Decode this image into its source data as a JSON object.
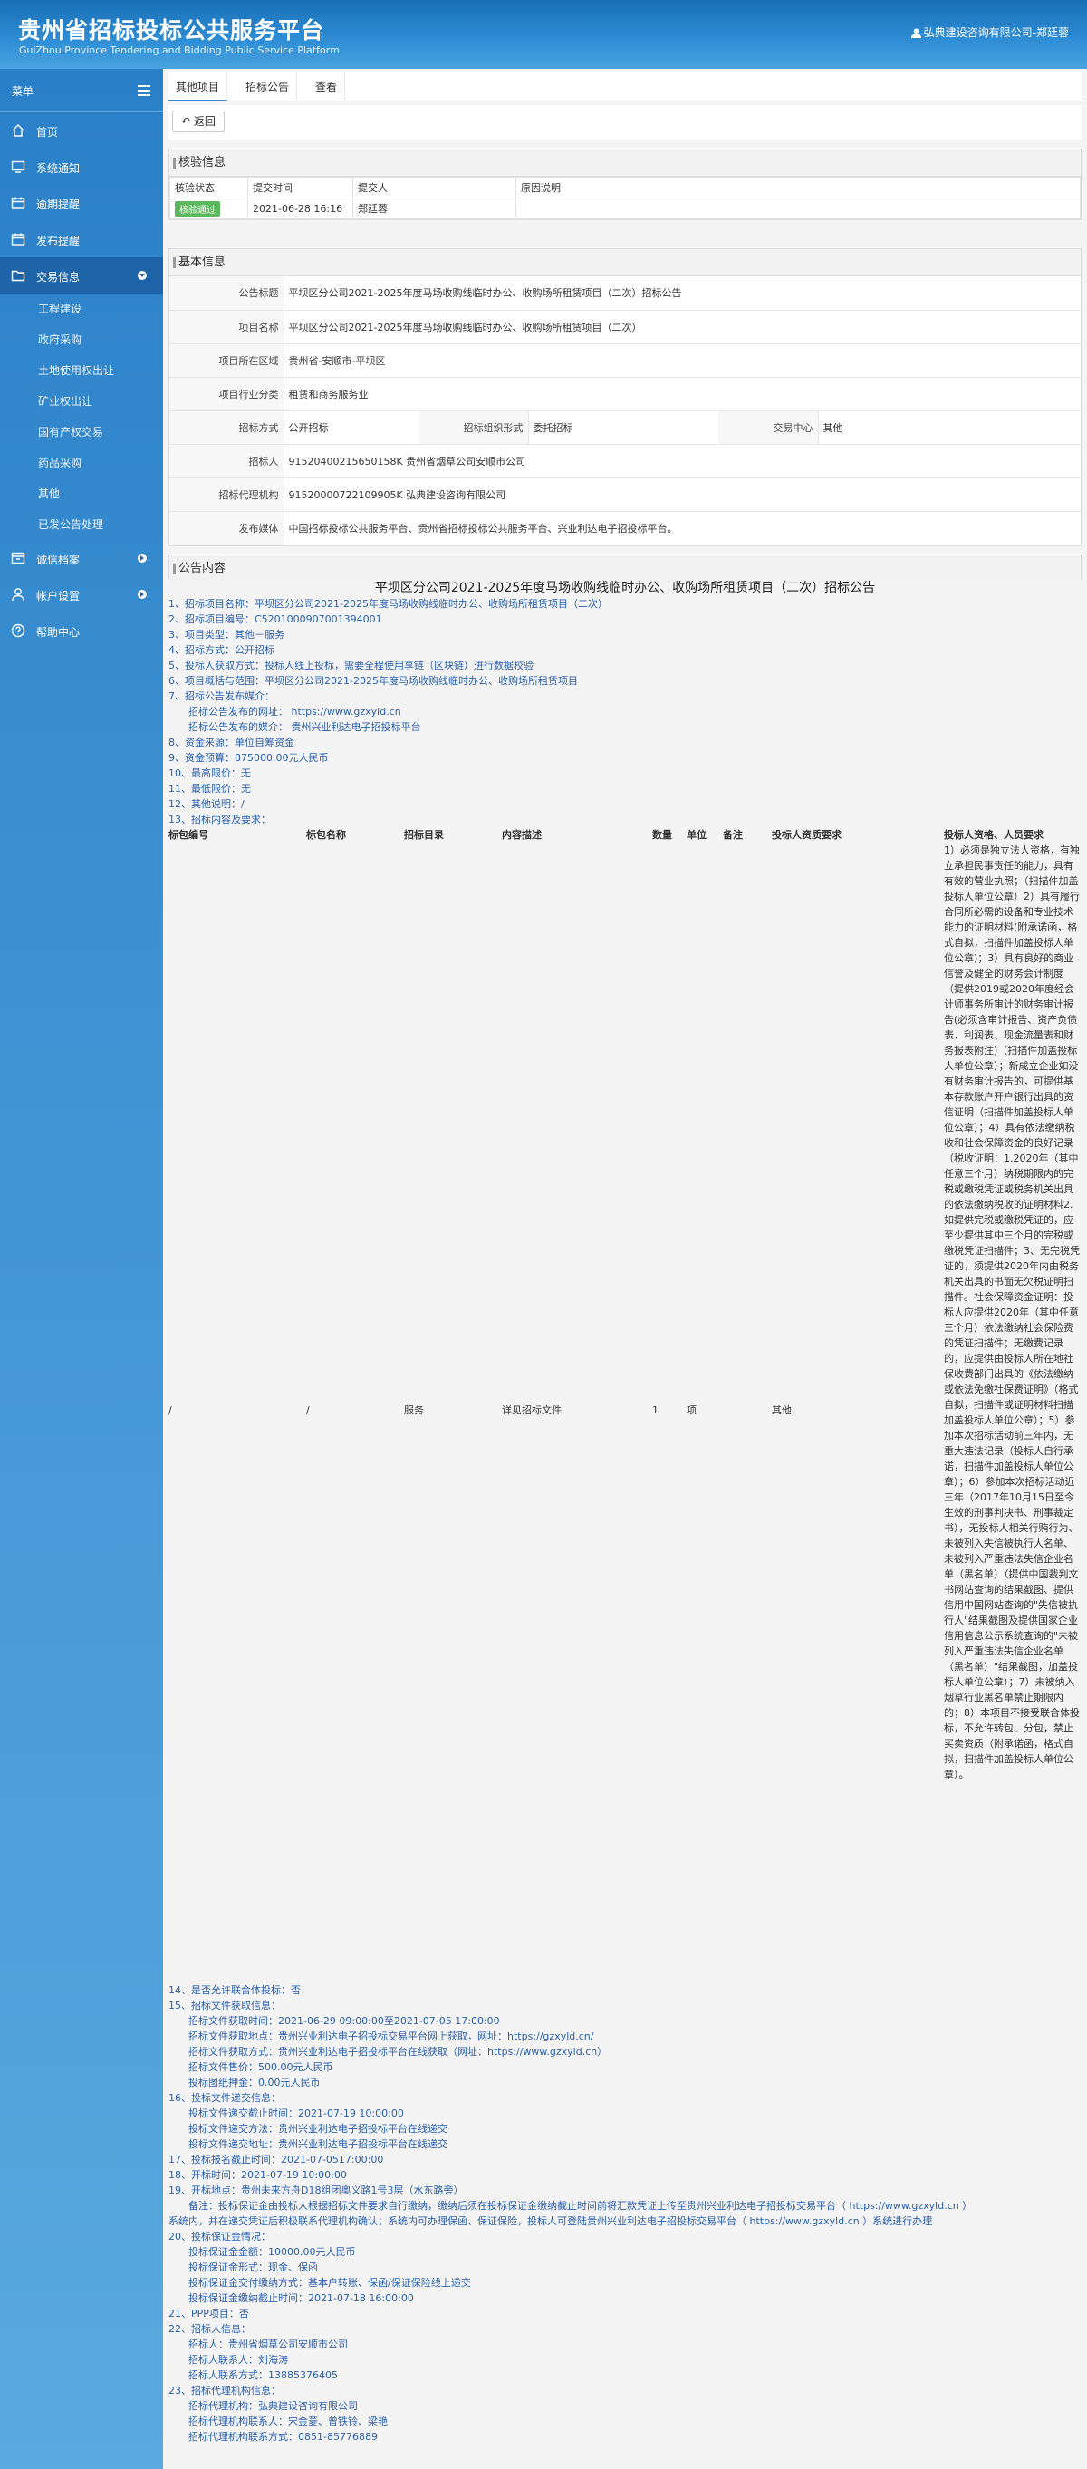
{
  "header": {
    "title": "贵州省招标投标公共服务平台",
    "subtitle": "GuiZhou Province Tendering and Bidding Public Service Platform",
    "user": "弘典建设咨询有限公司-郑廷蓉"
  },
  "sidebar": {
    "menu_label": "菜单",
    "items": [
      {
        "label": "首页"
      },
      {
        "label": "系统通知"
      },
      {
        "label": "逾期提醒"
      },
      {
        "label": "发布提醒"
      },
      {
        "label": "交易信息"
      }
    ],
    "sub_items": [
      "工程建设",
      "政府采购",
      "土地使用权出让",
      "矿业权出让",
      "国有产权交易",
      "药品采购",
      "其他",
      "已发公告处理"
    ],
    "bottom_items": [
      {
        "label": "诚信档案"
      },
      {
        "label": "帐户设置"
      },
      {
        "label": "帮助中心"
      }
    ]
  },
  "breadcrumb": [
    "其他项目",
    "招标公告",
    "查看"
  ],
  "toolbar": {
    "back_label": "返回"
  },
  "check": {
    "title": "核验信息",
    "headers": [
      "核验状态",
      "提交时间",
      "提交人",
      "原因说明"
    ],
    "status": "核验通过",
    "time": "2021-06-28 16:16",
    "submitter": "郑廷蓉",
    "reason": ""
  },
  "basic": {
    "title": "基本信息",
    "announcement_title_label": "公告标题",
    "announcement_title": "平坝区分公司2021-2025年度马场收购线临时办公、收购场所租赁项目（二次）招标公告",
    "project_name_label": "项目名称",
    "project_name": "平坝区分公司2021-2025年度马场收购线临时办公、收购场所租赁项目（二次）",
    "region_label": "项目所在区域",
    "region": "贵州省-安顺市-平坝区",
    "industry_label": "项目行业分类",
    "industry": "租赁和商务服务业",
    "method_label": "招标方式",
    "method": "公开招标",
    "org_form_label": "招标组织形式",
    "org_form": "委托招标",
    "center_label": "交易中心",
    "center": "其他",
    "tenderer_label": "招标人",
    "tenderer": "91520400215650158K 贵州省烟草公司安顺市公司",
    "agency_label": "招标代理机构",
    "agency": "91520000722109905K 弘典建设咨询有限公司",
    "media_label": "发布媒体",
    "media": "中国招标投标公共服务平台、贵州省招标投标公共服务平台、兴业利达电子招投标平台。"
  },
  "notice": {
    "title": "公告内容",
    "doc_title": "平坝区分公司2021-2025年度马场收购线临时办公、收购场所租赁项目（二次）招标公告",
    "lines_a": [
      "1、招标项目名称：平坝区分公司2021-2025年度马场收购线临时办公、收购场所租赁项目（二次）",
      "2、招标项目编号：C5201000907001394001",
      "3、项目类型：其他－服务",
      "4、招标方式：公开招标",
      "5、投标人获取方式：投标人线上投标，需要全程使用享链（区块链）进行数据校验",
      "6、项目概括与范围：平坝区分公司2021-2025年度马场收购线临时办公、收购场所租赁项目",
      "7、招标公告发布媒介：",
      "@招标公告发布的网址： https://www.gzxyld.cn",
      "@招标公告发布的媒介： 贵州兴业利达电子招投标平台",
      "8、资金来源：单位自筹资金",
      "9、资金预算：875000.00元人民币",
      "10、最高限价：无",
      "11、最低限价：无",
      "12、其他说明：/",
      "13、招标内容及要求："
    ],
    "table_headers": [
      "标包编号",
      "标包名称",
      "招标目录",
      "内容描述",
      "数量",
      "单位",
      "备注",
      "投标人资质要求",
      "投标人资格、人员要求"
    ],
    "table_row": [
      "/",
      "/",
      "服务",
      "详见招标文件",
      "1",
      "项",
      "",
      "其他"
    ],
    "requirement": "1）必须是独立法人资格，有独立承担民事责任的能力，具有有效的营业执照；（扫描件加盖投标人单位公章）2）具有履行合同所必需的设备和专业技术能力的证明材料(附承诺函，格式自拟，扫描件加盖投标人单位公章)；3）具有良好的商业信誉及健全的财务会计制度（提供2019或2020年度经会计师事务所审计的财务审计报告(必须含审计报告、资产负债表、利润表、现金流量表和财务报表附注)（扫描件加盖投标人单位公章）；新成立企业如没有财务审计报告的，可提供基本存款账户开户银行出具的资信证明（扫描件加盖投标人单位公章）；4）具有依法缴纳税收和社会保障资金的良好记录（税收证明：1.2020年（其中任意三个月）纳税期限内的完税或缴税凭证或税务机关出具的依法缴纳税收的证明材料2.如提供完税或缴税凭证的，应至少提供其中三个月的完税或缴税凭证扫描件；3、无完税凭证的，须提供2020年内由税务机关出具的书面无欠税证明扫描件。社会保障资金证明：投标人应提供2020年（其中任意三个月）依法缴纳社会保险费的凭证扫描件；无缴费记录的，应提供由投标人所在地社保收费部门出具的《依法缴纳或依法免缴社保费证明》（格式自拟，扫描件或证明材料扫描加盖投标人单位公章）；5）参加本次招标活动前三年内，无重大违法记录（投标人自行承诺，扫描件加盖投标人单位公章）；6）参加本次招标活动近三年（2017年10月15日至今生效的刑事判决书、刑事裁定书），无投标人相关行贿行为、未被列入失信被执行人名单、未被列入严重违法失信企业名单（黑名单）（提供中国裁判文书网站查询的结果截图、提供信用中国网站查询的\"失信被执行人\"结果截图及提供国家企业信用信息公示系统查询的\"未被列入严重违法失信企业名单（黑名单）\"结果截图，加盖投标人单位公章）；7）未被纳入烟草行业黑名单禁止期限内的；8）本项目不接受联合体投标，不允许转包、分包，禁止买卖资质（附承诺函，格式自拟，扫描件加盖投标人单位公章）。",
    "lines_b": [
      "14、是否允许联合体投标：否",
      "15、招标文件获取信息：",
      "@招标文件获取时间：2021-06-29 09:00:00至2021-07-05 17:00:00",
      "@招标文件获取地点：贵州兴业利达电子招投标交易平台网上获取，网址：https://gzxyld.cn/",
      "@招标文件获取方式：贵州兴业利达电子招投标平台在线获取（网址：https://www.gzxyld.cn）",
      "@招标文件售价：500.00元人民币",
      "@投标图纸押金：0.00元人民币",
      "16、投标文件递交信息：",
      "@投标文件递交截止时间：2021-07-19 10:00:00",
      "@投标文件递交方法：贵州兴业利达电子招投标平台在线递交",
      "@投标文件递交地址：贵州兴业利达电子招投标平台在线递交",
      "17、投标报名截止时间：2021-07-0517:00:00",
      "18、开标时间：2021-07-19 10:00:00",
      "19、开标地点：贵州未来方舟D18组团奥义路1号3层（水东路旁）",
      "@备注：投标保证金由投标人根据招标文件要求自行缴纳，缴纳后须在投标保证金缴纳截止时间前将汇款凭证上传至贵州兴业利达电子招投标交易平台（ https://www.gzxyld.cn ）",
      "系统内，并在递交凭证后积极联系代理机构确认；系统内可办理保函、保证保险，投标人可登陆贵州兴业利达电子招投标交易平台（ https://www.gzxyld.cn ）系统进行办理",
      "20、投标保证金情况：",
      "@投标保证金金额：10000.00元人民币",
      "@投标保证金形式：现金、保函",
      "@投标保证金交付缴纳方式：基本户转账、保函/保证保险线上递交",
      "@投标保证金缴纳截止时间：2021-07-18 16:00:00",
      "21、PPP项目：否",
      "22、招标人信息：",
      "@招标人：贵州省烟草公司安顺市公司",
      "@招标人联系人：刘海涛",
      "@招标人联系方式：13885376405",
      "23、招标代理机构信息：",
      "@招标代理机构：弘典建设咨询有限公司",
      "@招标代理机构联系人：宋金菱、曾铁铃、梁艳",
      "@招标代理机构联系方式：0851-85776889"
    ]
  },
  "colors": {
    "header": "#2f8ed6",
    "sidebar": "#3f93d4",
    "link": "#2a5fae",
    "badge": "#5cb85c"
  }
}
